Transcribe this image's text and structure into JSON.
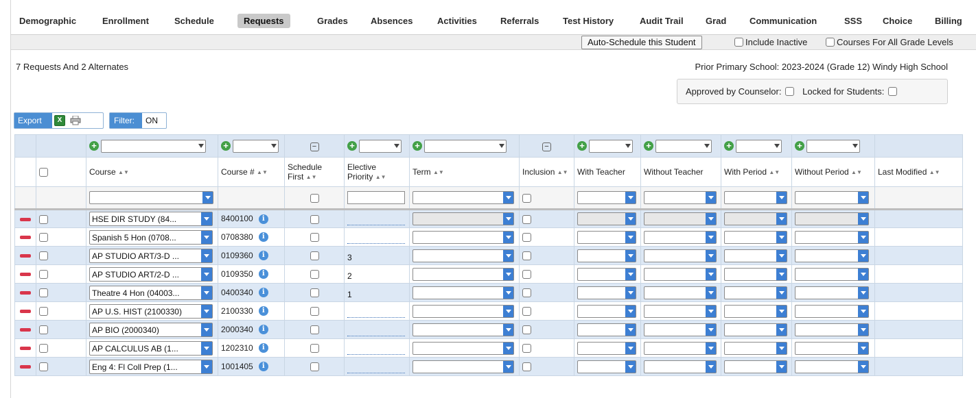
{
  "tabs": [
    "Demographic",
    "Enrollment",
    "Schedule",
    "Requests",
    "Grades",
    "Absences",
    "Activities",
    "Referrals",
    "Test History",
    "Audit Trail",
    "Grad",
    "Communication",
    "SSS",
    "Choice",
    "Billing"
  ],
  "active_tab": "Requests",
  "toolbar": {
    "auto_schedule": "Auto-Schedule this Student",
    "include_inactive": "Include Inactive",
    "all_grade_levels": "Courses For All Grade Levels"
  },
  "summary": "7 Requests And 2 Alternates",
  "prior_school": "Prior Primary School: 2023-2024 (Grade 12) Windy High School",
  "approval": {
    "approved_label": "Approved by Counselor:",
    "locked_label": "Locked for Students:"
  },
  "export": {
    "label": "Export",
    "xl_glyph": "X"
  },
  "filter": {
    "label": "Filter:",
    "value": "ON"
  },
  "columns": {
    "course": "Course",
    "course_num": "Course #",
    "schedule_first_1": "Schedule",
    "schedule_first_2": "First",
    "elective_1": "Elective",
    "elective_2": "Priority",
    "term": "Term",
    "inclusion": "Inclusion",
    "with_teacher": "With Teacher",
    "without_teacher": "Without Teacher",
    "with_period": "With Period",
    "without_period": "Without Period",
    "last_modified": "Last Modified"
  },
  "rows": [
    {
      "course": "HSE DIR STUDY (84...",
      "num": "8400100",
      "ep": ""
    },
    {
      "course": "Spanish 5 Hon (0708...",
      "num": "0708380",
      "ep": ""
    },
    {
      "course": "AP STUDIO ART/3-D ...",
      "num": "0109360",
      "ep": "3"
    },
    {
      "course": "AP STUDIO ART/2-D ...",
      "num": "0109350",
      "ep": "2"
    },
    {
      "course": "Theatre 4 Hon (04003...",
      "num": "0400340",
      "ep": "1"
    },
    {
      "course": "AP U.S. HIST (2100330)",
      "num": "2100330",
      "ep": ""
    },
    {
      "course": "AP BIO (2000340)",
      "num": "2000340",
      "ep": ""
    },
    {
      "course": "AP CALCULUS AB (1...",
      "num": "1202310",
      "ep": ""
    },
    {
      "course": "Eng 4: Fl Coll Prep (1...",
      "num": "1001405",
      "ep": ""
    }
  ],
  "icons": {
    "plus": "plus-circle-icon",
    "minus": "minus-square-icon",
    "delete": "delete-icon",
    "info": "info-icon",
    "info_glyph": "i",
    "plus_glyph": "+",
    "minus_glyph": "−",
    "sort_glyph": "▲▼"
  }
}
